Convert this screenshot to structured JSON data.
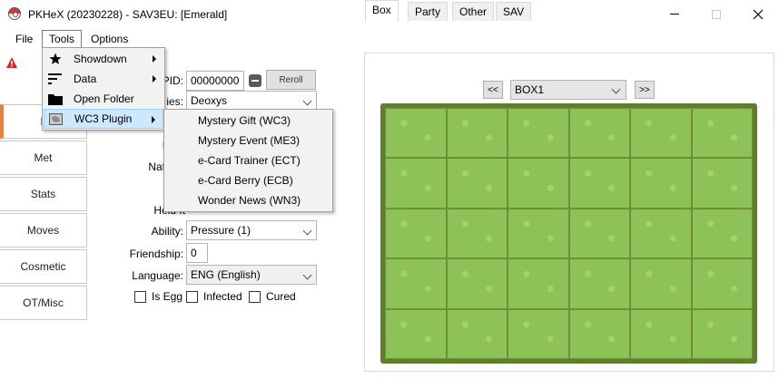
{
  "window": {
    "title": "PKHeX (20230228) - SAV3EU: [Emerald]",
    "icons": {
      "app": "pokeball-icon",
      "minimize": "minimize-icon",
      "maximize": "maximize-icon",
      "close": "close-icon"
    }
  },
  "menubar": {
    "file": "File",
    "tools": "Tools",
    "options": "Options"
  },
  "tools_menu": {
    "items": [
      {
        "label": "Showdown",
        "icon": "star-icon",
        "has_submenu": true
      },
      {
        "label": "Data",
        "icon": "data-bars-icon",
        "has_submenu": true
      },
      {
        "label": "Open Folder",
        "icon": "folder-icon",
        "has_submenu": false
      },
      {
        "label": "WC3 Plugin",
        "icon": "plugin-icon",
        "has_submenu": true
      }
    ]
  },
  "wc3_submenu": {
    "items": [
      {
        "label": "Mystery Gift (WC3)"
      },
      {
        "label": "Mystery Event (ME3)"
      },
      {
        "label": "e-Card Trainer (ECT)"
      },
      {
        "label": "e-Card Berry (ECB)"
      },
      {
        "label": "Wonder News (WN3)"
      }
    ]
  },
  "side_tabs": [
    {
      "label": "M"
    },
    {
      "label": "Met"
    },
    {
      "label": "Stats"
    },
    {
      "label": "Moves"
    },
    {
      "label": "Cosmetic"
    },
    {
      "label": "OT/Misc"
    }
  ],
  "form": {
    "pid_label": "PID:",
    "pid_value": "00000000",
    "reroll_label": "Reroll",
    "species_label": "ies:",
    "species_value": "Deoxys",
    "partial_label_1": "I",
    "nature_label": "Nat",
    "held_item_label": "Held It",
    "ability_label": "Ability:",
    "ability_value": "Pressure (1)",
    "friendship_label": "Friendship:",
    "friendship_value": "0",
    "language_label": "Language:",
    "language_value": "ENG (English)",
    "is_egg_label": "Is Egg",
    "infected_label": "Infected",
    "cured_label": "Cured"
  },
  "right_panel": {
    "tabs": [
      {
        "label": "Box"
      },
      {
        "label": "Party"
      },
      {
        "label": "Other"
      },
      {
        "label": "SAV"
      }
    ],
    "prev_label": "<<",
    "next_label": ">>",
    "box_name": "BOX1",
    "rows": 5,
    "cols": 6
  },
  "colors": {
    "selected_tab_accent": "#e8803a",
    "box_grass": "#8cc258",
    "menu_highlight": "#cce8ff"
  }
}
